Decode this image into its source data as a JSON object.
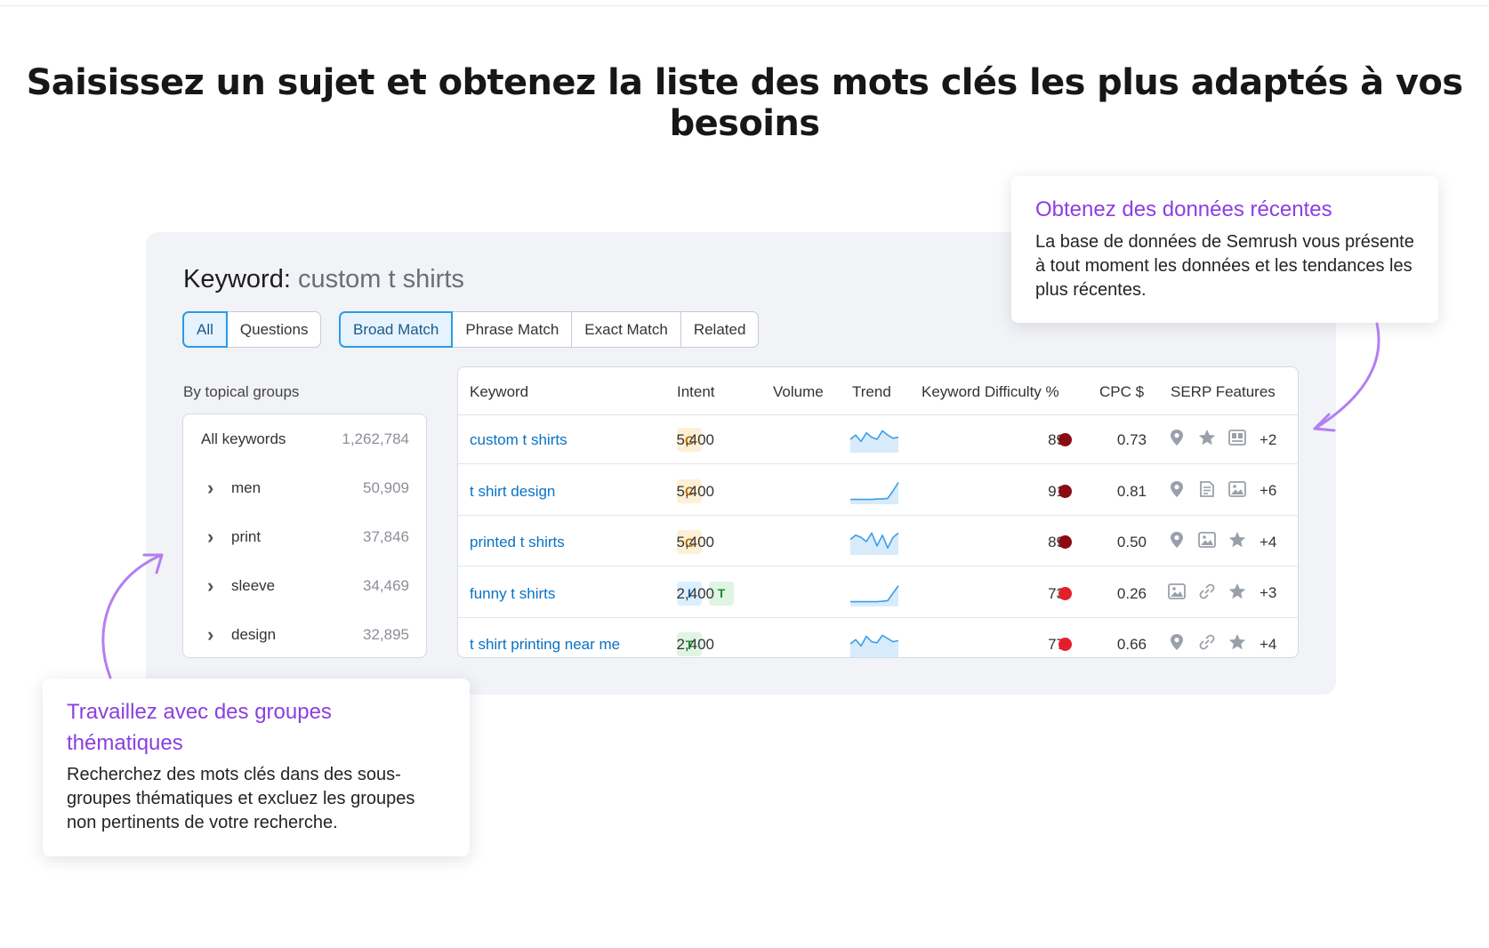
{
  "headline": "Saisissez un sujet et obtenez la liste des mots clés les plus adaptés à vos besoins",
  "keyword": {
    "label": "Keyword:",
    "value": "custom t shirts"
  },
  "tabs_group_a": [
    {
      "label": "All",
      "active": true
    },
    {
      "label": "Questions",
      "active": false
    }
  ],
  "tabs_group_b": [
    {
      "label": "Broad Match",
      "active": true
    },
    {
      "label": "Phrase Match",
      "active": false
    },
    {
      "label": "Exact Match",
      "active": false
    },
    {
      "label": "Related",
      "active": false
    }
  ],
  "groups": {
    "label": "By topical groups",
    "items": [
      {
        "name": "All keywords",
        "count": "1,262,784"
      },
      {
        "name": "men",
        "count": "50,909"
      },
      {
        "name": "print",
        "count": "37,846"
      },
      {
        "name": "sleeve",
        "count": "34,469"
      },
      {
        "name": "design",
        "count": "32,895"
      }
    ]
  },
  "table": {
    "headers": {
      "keyword": "Keyword",
      "intent": "Intent",
      "volume": "Volume",
      "trend": "Trend",
      "kd": "Keyword Difficulty %",
      "cpc": "CPC $",
      "serp": "SERP Features"
    },
    "rows": [
      {
        "keyword": "custom t shirts",
        "intent": [
          "C"
        ],
        "volume": "5,400",
        "trend": [
          0.5,
          0.7,
          0.4,
          0.8,
          0.6,
          0.5,
          0.9,
          0.7,
          0.55,
          0.6
        ],
        "kd": "89",
        "kd_color": "#8b0b12",
        "cpc": "0.73",
        "serp_icons": [
          "location-pin-icon",
          "star-icon",
          "ad-icon"
        ],
        "serp_more": "+2"
      },
      {
        "keyword": "t shirt design",
        "intent": [
          "C"
        ],
        "volume": "5,400",
        "trend": [
          0.1,
          0.1,
          0.1,
          0.1,
          0.1,
          0.12,
          0.12,
          0.15,
          0.5,
          0.9
        ],
        "kd": "91",
        "kd_color": "#8b0b12",
        "cpc": "0.81",
        "serp_icons": [
          "location-pin-icon",
          "article-icon",
          "image-icon"
        ],
        "serp_more": "+6"
      },
      {
        "keyword": "printed t shirts",
        "intent": [
          "C"
        ],
        "volume": "5,400",
        "trend": [
          0.6,
          0.8,
          0.7,
          0.5,
          0.9,
          0.3,
          0.8,
          0.2,
          0.7,
          0.9
        ],
        "kd": "89",
        "kd_color": "#8b0b12",
        "cpc": "0.50",
        "serp_icons": [
          "location-pin-icon",
          "image-icon",
          "star-icon"
        ],
        "serp_more": "+4"
      },
      {
        "keyword": "funny t shirts",
        "intent": [
          "I",
          "T"
        ],
        "volume": "2,400",
        "trend": [
          0.1,
          0.1,
          0.1,
          0.1,
          0.1,
          0.1,
          0.12,
          0.15,
          0.5,
          0.85
        ],
        "kd": "73",
        "kd_color": "#e3202a",
        "cpc": "0.26",
        "serp_icons": [
          "image-icon",
          "link-icon",
          "star-icon"
        ],
        "serp_more": "+3"
      },
      {
        "keyword": "t shirt printing near me",
        "intent": [
          "T"
        ],
        "volume": "2,400",
        "trend": [
          0.5,
          0.7,
          0.4,
          0.85,
          0.6,
          0.55,
          0.9,
          0.75,
          0.6,
          0.65
        ],
        "kd": "77",
        "kd_color": "#e3202a",
        "cpc": "0.66",
        "serp_icons": [
          "location-pin-icon",
          "link-icon",
          "star-icon"
        ],
        "serp_more": "+4"
      }
    ]
  },
  "callouts": {
    "top": {
      "title": "Obtenez des données récentes",
      "body": "La base de données de Semrush vous présente à tout moment les données et les tendances les plus récentes."
    },
    "bottom": {
      "title": "Travaillez avec des groupes thématiques",
      "body": "Recherchez des mots clés dans des sous-groupes thématiques et excluez les groupes non pertinents de votre recherche."
    }
  },
  "colors": {
    "accent": "#8b3fe0",
    "link": "#0a72c4",
    "tab_active_border": "#2b9be6",
    "trend_line": "#3a9ee6",
    "trend_fill": "#d7ebfb"
  }
}
